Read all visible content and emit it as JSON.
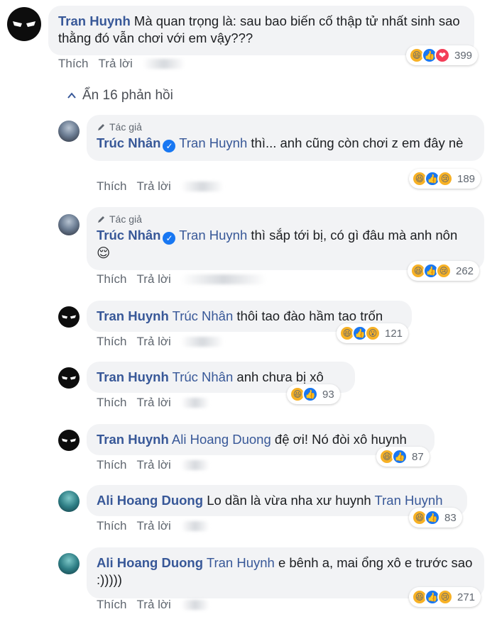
{
  "labels": {
    "like": "Thích",
    "reply": "Trả lời",
    "author_badge": "Tác giả",
    "hide_replies": "Ẩn 16 phản hồi"
  },
  "comments": [
    {
      "author": "Tran Huynh",
      "mention": "",
      "text": "Mà quan trọng là: sau bao biến cố thập tử nhất sinh sao thằng đó vẫn chơi với em vậy???",
      "reaction_count": "399",
      "reactions": [
        "haha",
        "like",
        "love"
      ]
    },
    {
      "author": "Trúc Nhân",
      "mention": "Tran Huynh",
      "text": "thì... anh cũng còn chơi z em đây nè",
      "reaction_count": "189",
      "reactions": [
        "haha",
        "like",
        "sad"
      ]
    },
    {
      "author": "Trúc Nhân",
      "mention": "Tran Huynh",
      "text": "thì sắp tới bị, có gì đâu mà anh nôn 😌",
      "reaction_count": "262",
      "reactions": [
        "haha",
        "like",
        "sad"
      ]
    },
    {
      "author": "Tran Huynh",
      "mention": "Trúc Nhân",
      "text": "thôi tao đào hầm tao trốn",
      "reaction_count": "121",
      "reactions": [
        "haha",
        "like",
        "wow"
      ]
    },
    {
      "author": "Tran Huynh",
      "mention": "Trúc Nhân",
      "text": "anh chưa bị xô",
      "reaction_count": "93",
      "reactions": [
        "haha",
        "like"
      ]
    },
    {
      "author": "Tran Huynh",
      "mention": "Ali Hoang Duong",
      "text": "đệ ơi! Nó đòi xô huynh",
      "reaction_count": "87",
      "reactions": [
        "haha",
        "like"
      ]
    },
    {
      "author": "Ali Hoang Duong",
      "mention": "",
      "text": "Lo dần là vừa nha xư huynh",
      "mention_after": "Tran Huynh",
      "reaction_count": "83",
      "reactions": [
        "haha",
        "like"
      ]
    },
    {
      "author": "Ali Hoang Duong",
      "mention": "Tran Huynh",
      "text": "e bênh a, mai ổng xô e trước sao :)))))",
      "reaction_count": "271",
      "reactions": [
        "haha",
        "like",
        "sad"
      ]
    }
  ],
  "colors": {
    "link": "#385898",
    "bubble": "#f2f3f5",
    "meta": "#606770"
  }
}
